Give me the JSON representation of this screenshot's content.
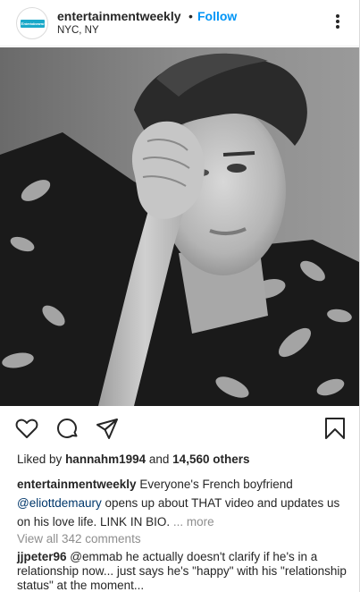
{
  "header": {
    "avatar_logo_text": "Entertainment",
    "username": "entertainmentweekly",
    "separator": "•",
    "follow_label": "Follow",
    "location": "NYC, NY"
  },
  "actions": {
    "icons": [
      "heart-icon",
      "comment-icon",
      "share-icon",
      "bookmark-icon"
    ]
  },
  "likes": {
    "prefix": "Liked by",
    "liker": "hannahm1994",
    "conjunction": "and",
    "others": "14,560 others"
  },
  "caption": {
    "username": "entertainmentweekly",
    "text_1": "Everyone's French boyfriend",
    "mention": "@eliottdemaury",
    "text_2": "opens up about THAT video and updates us on his love life. LINK IN BIO.",
    "more_label": "... more"
  },
  "comments": {
    "view_all_label": "View all 342 comments",
    "items": [
      {
        "username": "jjpeter96",
        "text": "@emmab he actually doesn't clarify if he's in a relationship now... just says he's \"happy\" with his \"relationship status\" at the moment..."
      }
    ]
  },
  "colors": {
    "accent": "#0095f6",
    "mention": "#00376b",
    "muted": "#8e8e8e",
    "text": "#262626",
    "logo": "#1aa9c9"
  }
}
